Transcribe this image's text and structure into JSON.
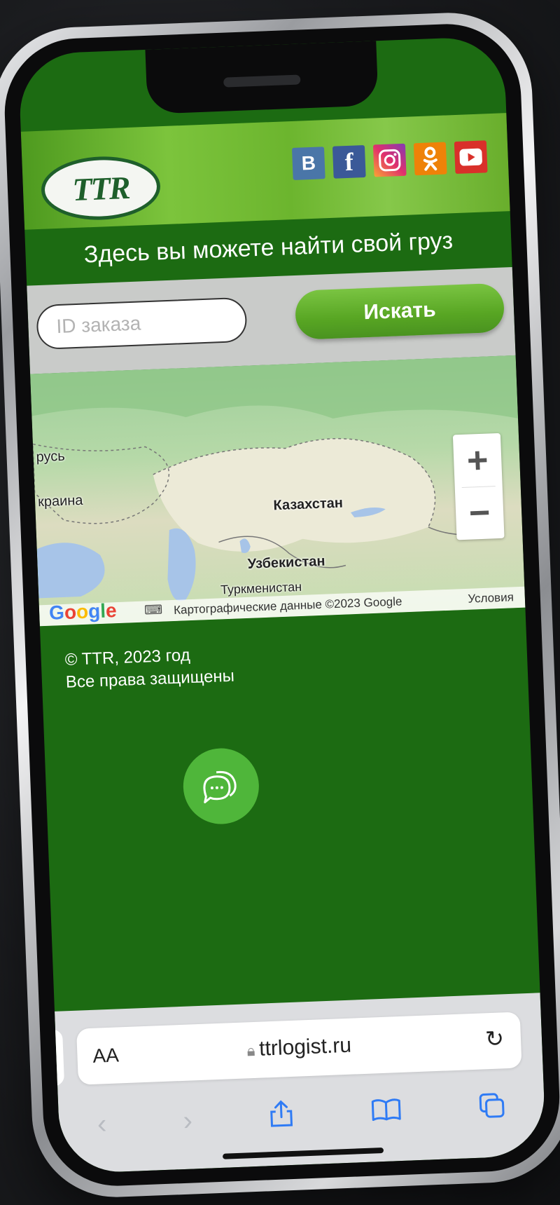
{
  "header": {
    "logo_text": "TTR",
    "socials": [
      {
        "label": "B",
        "icon": "vk-icon",
        "color": "#4a76a8"
      },
      {
        "label": "f",
        "icon": "facebook-icon",
        "color": "#3b5998"
      },
      {
        "label": "",
        "icon": "instagram-icon",
        "color": "#e1306c"
      },
      {
        "label": "",
        "icon": "odnoklassniki-icon",
        "color": "#ee8208"
      },
      {
        "label": "",
        "icon": "youtube-icon",
        "color": "#d9302a"
      }
    ]
  },
  "tagline": "Здесь вы можете найти свой груз",
  "search": {
    "placeholder": "ID заказа",
    "value": "",
    "button_label": "Искать"
  },
  "map": {
    "labels": [
      "русь",
      "краина",
      "Казахстан",
      "Узбекистан",
      "Туркменистан"
    ],
    "zoom_in": "+",
    "zoom_out": "−",
    "google_logo": "Google",
    "attribution": "Картографические данные ©2023 Google",
    "terms": "Условия"
  },
  "footer": {
    "copyright": "© TTR, 2023 год",
    "rights": "Все права защищены"
  },
  "browser": {
    "text_size": "AA",
    "url": "ttrlogist.ru"
  },
  "colors": {
    "page_green": "#1c6b12",
    "accent_green": "#58a623",
    "browser_blue": "#2f7bf5"
  }
}
